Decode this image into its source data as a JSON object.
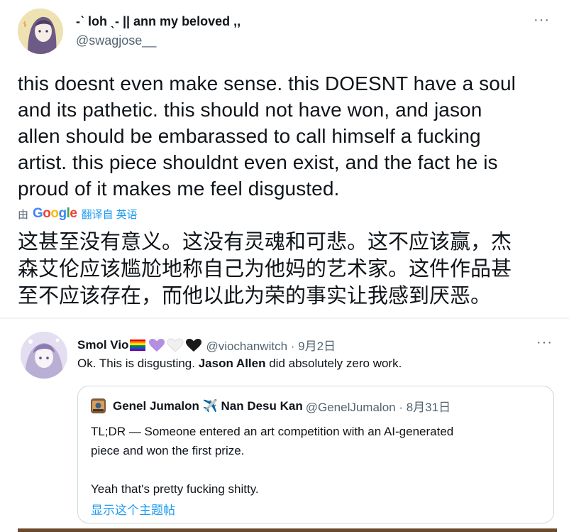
{
  "main_tweet": {
    "display_name": "-ˋ loh ˎ- || ann my beloved ,,",
    "handle": "@swagjose__",
    "more_label": "···",
    "text": "this doesnt even make sense. this DOESNT have a soul\nand its pathetic. this should not have won, and jason\nallen should be embarassed to call himself a fucking\nartist. this piece shouldnt even exist, and the fact he is\nproud of it makes me feel disgusted.",
    "translate_by": "由",
    "translate_from": "翻译自 英语",
    "translated_text": "这甚至没有意义。这没有灵魂和可悲。这不应该赢，杰\n森艾伦应该尴尬地称自己为他妈的艺术家。这件作品甚\n至不应该存在，而他以此为荣的事实让我感到厌恶。"
  },
  "reply_tweet": {
    "display_name": "Smol Vio",
    "emojis": [
      "rainbow-flag-icon",
      "purple-heart-icon",
      "white-heart-icon",
      "black-heart-icon"
    ],
    "handle_date": "@viochanwitch · 9月2日",
    "more_label": "···",
    "text_before": "Ok. This is disgusting. ",
    "text_bold": "Jason Allen",
    "text_after": " did absolutely zero work.",
    "quote": {
      "display_name": "Genel Jumalon ✈️ Nan Desu Kan",
      "handle_date": "@GenelJumalon · 8月31日",
      "text": "TL;DR — Someone entered an art competition with an AI-generated\npiece and won the first prize.\n\nYeah that's pretty fucking shitty.",
      "show_thread": "显示这个主题帖"
    }
  },
  "colors": {
    "text_primary": "#0f1419",
    "text_secondary": "#536471",
    "link_blue": "#1d9bf0",
    "border": "#cfd9de",
    "google_blue": "#4285f4",
    "google_red": "#ea4335",
    "google_yellow": "#fbbc05",
    "google_green": "#34a853"
  }
}
